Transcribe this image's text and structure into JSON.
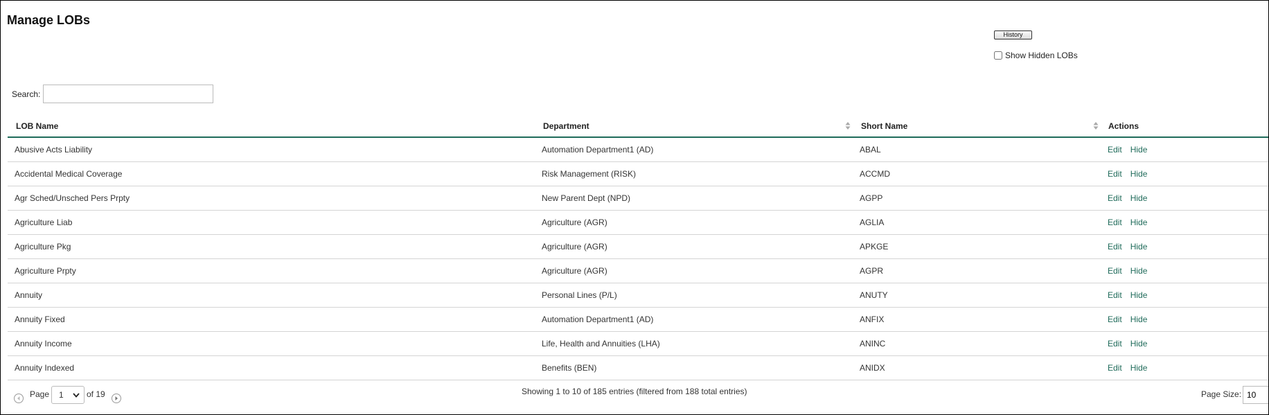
{
  "page": {
    "title": "Manage LOBs",
    "history_label": "History",
    "show_hidden_label": "Show Hidden LOBs",
    "show_hidden_checked": false
  },
  "search": {
    "label": "Search:",
    "value": ""
  },
  "table": {
    "columns": [
      "LOB Name",
      "Department",
      "Short Name",
      "Actions"
    ],
    "edit_label": "Edit",
    "hide_label": "Hide",
    "rows": [
      {
        "name": "Abusive Acts Liability",
        "department": "Automation Department1 (AD)",
        "short": "ABAL"
      },
      {
        "name": "Accidental Medical Coverage",
        "department": "Risk Management (RISK)",
        "short": "ACCMD"
      },
      {
        "name": "Agr Sched/Unsched Pers Prpty",
        "department": "New Parent Dept (NPD)",
        "short": "AGPP"
      },
      {
        "name": "Agriculture Liab",
        "department": "Agriculture (AGR)",
        "short": "AGLIA"
      },
      {
        "name": "Agriculture Pkg",
        "department": "Agriculture (AGR)",
        "short": "APKGE"
      },
      {
        "name": "Agriculture Prpty",
        "department": "Agriculture (AGR)",
        "short": "AGPR"
      },
      {
        "name": "Annuity",
        "department": "Personal Lines (P/L)",
        "short": "ANUTY"
      },
      {
        "name": "Annuity Fixed",
        "department": "Automation Department1 (AD)",
        "short": "ANFIX"
      },
      {
        "name": "Annuity Income",
        "department": "Life, Health and Annuities (LHA)",
        "short": "ANINC"
      },
      {
        "name": "Annuity Indexed",
        "department": "Benefits (BEN)",
        "short": "ANIDX"
      }
    ]
  },
  "pager": {
    "page_label": "Page",
    "current_page": "1",
    "of_label": "of 19",
    "info": "Showing 1 to 10 of 185 entries (filtered from 188 total entries)",
    "page_size_label": "Page Size:",
    "page_size": "10"
  },
  "icons": {
    "sort": "sort-icon",
    "prev": "chevron-left-icon",
    "next": "chevron-right-icon",
    "dropdown": "chevron-down-icon"
  },
  "colors": {
    "accent": "#1f6b5a",
    "text": "#333333",
    "row_border": "#d4d4d4"
  }
}
